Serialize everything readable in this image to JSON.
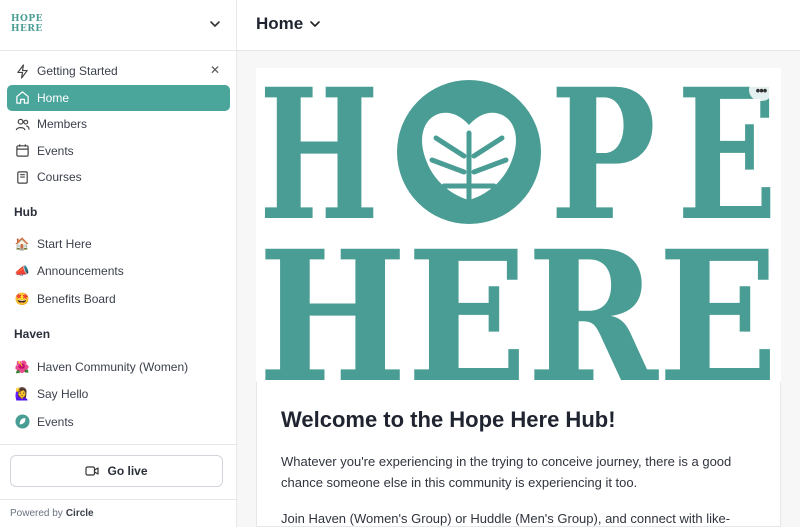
{
  "brand": {
    "logo_line1": "HOPE",
    "logo_line2": "HERE"
  },
  "sidebar": {
    "getting_started": "Getting Started",
    "items": [
      {
        "label": "Home",
        "icon": "home-icon",
        "active": true
      },
      {
        "label": "Members",
        "icon": "members-icon"
      },
      {
        "label": "Events",
        "icon": "calendar-icon"
      },
      {
        "label": "Courses",
        "icon": "book-icon"
      }
    ],
    "sections": [
      {
        "title": "Hub",
        "items": [
          {
            "label": "Start Here",
            "icon": "house-emoji-icon",
            "emoji": "🏠"
          },
          {
            "label": "Announcements",
            "icon": "megaphone-emoji-icon",
            "emoji": "📣"
          },
          {
            "label": "Benefits Board",
            "icon": "star-struck-emoji-icon",
            "emoji": "🤩"
          }
        ]
      },
      {
        "title": "Haven",
        "items": [
          {
            "label": "Haven Community (Women)",
            "icon": "hibiscus-emoji-icon",
            "emoji": "🌺"
          },
          {
            "label": "Say Hello",
            "icon": "waving-person-emoji-icon",
            "emoji": "🙋‍♀️"
          },
          {
            "label": "Events",
            "icon": "leaf-logo-icon"
          }
        ]
      }
    ],
    "go_live": "Go live",
    "powered_by": "Powered by",
    "powered_brand": "Circle"
  },
  "header": {
    "title": "Home"
  },
  "hero": {
    "line1": "HOPE",
    "line2": "HERE",
    "more": "•••"
  },
  "post": {
    "title": "Welcome to the Hope Here Hub!",
    "para1": "Whatever you're experiencing in the trying to conceive journey, there is a good chance someone else in this community is experiencing it too.",
    "para2": "Join Haven (Women's Group) or Huddle (Men's Group), and connect with like-"
  },
  "colors": {
    "brand": "#4a9d94",
    "active": "#4aa59b"
  }
}
